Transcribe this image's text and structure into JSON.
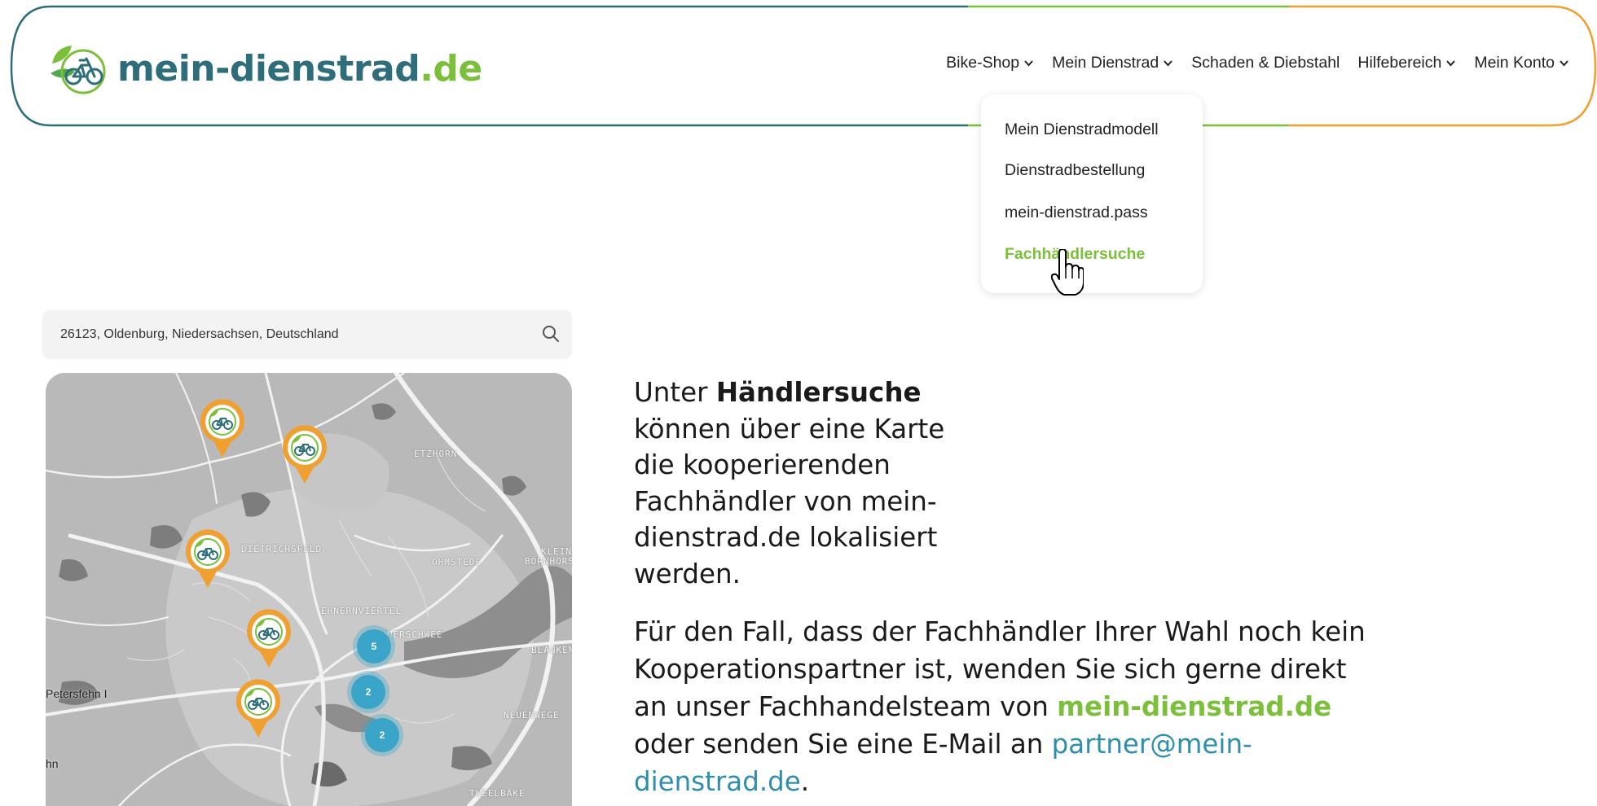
{
  "site": {
    "logo_text": "mein-dienstrad",
    "logo_tld": ".de"
  },
  "nav": {
    "items": [
      {
        "label": "Bike-Shop",
        "has_dropdown": true
      },
      {
        "label": "Mein Dienstrad",
        "has_dropdown": true
      },
      {
        "label": "Schaden & Diebstahl",
        "has_dropdown": false
      },
      {
        "label": "Hilfebereich",
        "has_dropdown": true
      },
      {
        "label": "Mein Konto",
        "has_dropdown": true
      }
    ]
  },
  "dropdown": {
    "parent": "Mein Dienstrad",
    "items": [
      {
        "label": "Mein Dienstradmodell",
        "active": false
      },
      {
        "label": "Dienstradbestellung",
        "active": false
      },
      {
        "label": "mein-dienstrad.pass",
        "active": false
      },
      {
        "label": "Fachhändlersuche",
        "active": true
      }
    ]
  },
  "search": {
    "value": "26123, Oldenburg, Niedersachsen, Deutschland",
    "icon": "search-icon"
  },
  "map": {
    "labels": {
      "etzhorn": "ETZHORN",
      "dietrichsfeld": "DIETRICHSFELD",
      "ohmstede": "OHMSTEDE",
      "klein_bornhorst": "KLEIN BORNHORST",
      "ehnernviertel": "EHNERNVIERTEL",
      "donnerschwee": "DONNERSCHWEE",
      "blankenburg": "BLANKEN",
      "petersfehn": "Petersfehn I",
      "neuenwege": "NEUENWEGE",
      "tweelbaeke": "TWEELBÄKE",
      "edge": "hn"
    },
    "marker_icon": "dealer-marker-icon",
    "marker_count": 5,
    "clusters": [
      "5",
      "2",
      "2"
    ],
    "colors": {
      "marker": "#f0a030",
      "cluster": "#3aa5c9",
      "map_bg": "#b9b9b9"
    }
  },
  "intro": {
    "prefix": "Unter ",
    "bold": "Händlersuche",
    "rest": " können über eine Karte die kooperierenden Fachhändler von mein-dienstrad.de lokalisiert werden."
  },
  "body": {
    "text1": "Für den Fall, dass der Fachhändler Ihrer Wahl noch kein Kooperationspartner ist, wenden Sie sich gerne direkt an unser Fachhandelsteam von ",
    "link1": "mein-dienstrad.de",
    "text2": " oder senden Sie eine E-Mail an ",
    "link2": "partner@mein-dienstrad.de",
    "text3": "."
  },
  "colors": {
    "teal": "#2d6e7a",
    "green": "#7bbf3a",
    "orange": "#f0a030",
    "link_blue": "#2d8fad"
  }
}
